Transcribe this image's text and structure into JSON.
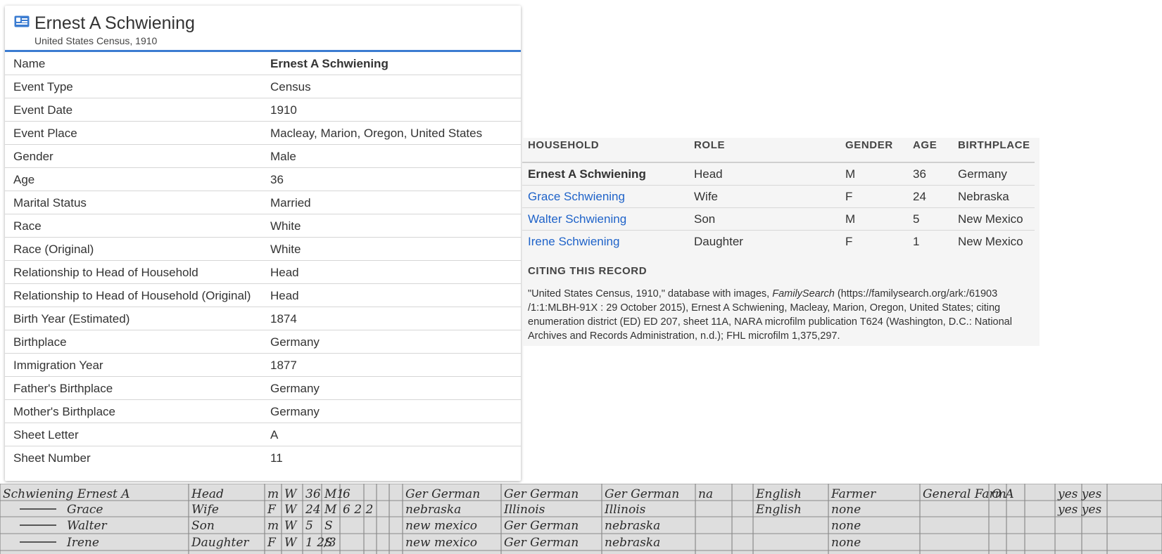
{
  "record": {
    "name": "Ernest A Schwiening",
    "collection": "United States Census, 1910",
    "facts": [
      {
        "label": "Name",
        "value": "Ernest A Schwiening"
      },
      {
        "label": "Event Type",
        "value": "Census"
      },
      {
        "label": "Event Date",
        "value": "1910"
      },
      {
        "label": "Event Place",
        "value": "Macleay, Marion, Oregon, United States"
      },
      {
        "label": "Gender",
        "value": "Male"
      },
      {
        "label": "Age",
        "value": "36"
      },
      {
        "label": "Marital Status",
        "value": "Married"
      },
      {
        "label": "Race",
        "value": "White"
      },
      {
        "label": "Race (Original)",
        "value": "White"
      },
      {
        "label": "Relationship to Head of Household",
        "value": "Head"
      },
      {
        "label": "Relationship to Head of Household (Original)",
        "value": "Head"
      },
      {
        "label": "Birth Year (Estimated)",
        "value": "1874"
      },
      {
        "label": "Birthplace",
        "value": "Germany"
      },
      {
        "label": "Immigration Year",
        "value": "1877"
      },
      {
        "label": "Father's Birthplace",
        "value": "Germany"
      },
      {
        "label": "Mother's Birthplace",
        "value": "Germany"
      },
      {
        "label": "Sheet Letter",
        "value": "A"
      },
      {
        "label": "Sheet Number",
        "value": "11"
      }
    ]
  },
  "household": {
    "headers": [
      "HOUSEHOLD",
      "ROLE",
      "GENDER",
      "AGE",
      "BIRTHPLACE"
    ],
    "members": [
      {
        "name": "Ernest A Schwiening",
        "role": "Head",
        "gender": "M",
        "age": "36",
        "birthplace": "Germany",
        "is_link": false
      },
      {
        "name": "Grace Schwiening",
        "role": "Wife",
        "gender": "F",
        "age": "24",
        "birthplace": "Nebraska",
        "is_link": true
      },
      {
        "name": "Walter Schwiening",
        "role": "Son",
        "gender": "M",
        "age": "5",
        "birthplace": "New Mexico",
        "is_link": true
      },
      {
        "name": "Irene Schwiening",
        "role": "Daughter",
        "gender": "F",
        "age": "1",
        "birthplace": "New Mexico",
        "is_link": true
      }
    ]
  },
  "citation": {
    "heading": "CITING THIS RECORD",
    "prefix": "\"United States Census, 1910,\" database with images, ",
    "source": "FamilySearch",
    "text": " (https://familysearch.org/ark:/61903 /1:1:MLBH-91X : 29 October 2015), Ernest A Schwiening, Macleay, Marion, Oregon, United States; citing enumeration district (ED) ED 207, sheet 11A, NARA microfilm publication T624 (Washington, D.C.: National Archives and Records Administration, n.d.); FHL microfilm 1,375,297."
  },
  "census_image": {
    "rows": [
      [
        "Schwiening Ernest A",
        "Head",
        "m",
        "W",
        "36",
        "M1",
        "6",
        "Ger German",
        "Ger German",
        "Ger German",
        "na",
        "English",
        "Farmer",
        "General Farm",
        "O A",
        "yes yes"
      ],
      [
        "Grace",
        "Wife",
        "F",
        "W",
        "24",
        "M",
        "6 2 2",
        "nebraska",
        "Illinois",
        "Illinois",
        "",
        "English",
        "none",
        "",
        "",
        "yes yes"
      ],
      [
        "Walter",
        "Son",
        "m",
        "W",
        "5",
        "S",
        "",
        "new mexico",
        "Ger German",
        "nebraska",
        "",
        "",
        "none",
        "",
        "",
        ""
      ],
      [
        "Irene",
        "Daughter",
        "F",
        "W",
        "1 2/3",
        "S",
        "",
        "new mexico",
        "Ger German",
        "nebraska",
        "",
        "",
        "none",
        "",
        "",
        ""
      ]
    ]
  },
  "colors": {
    "accent": "#3b7cd1",
    "link": "#1f63c9",
    "panel_bg": "#f5f5f5"
  }
}
